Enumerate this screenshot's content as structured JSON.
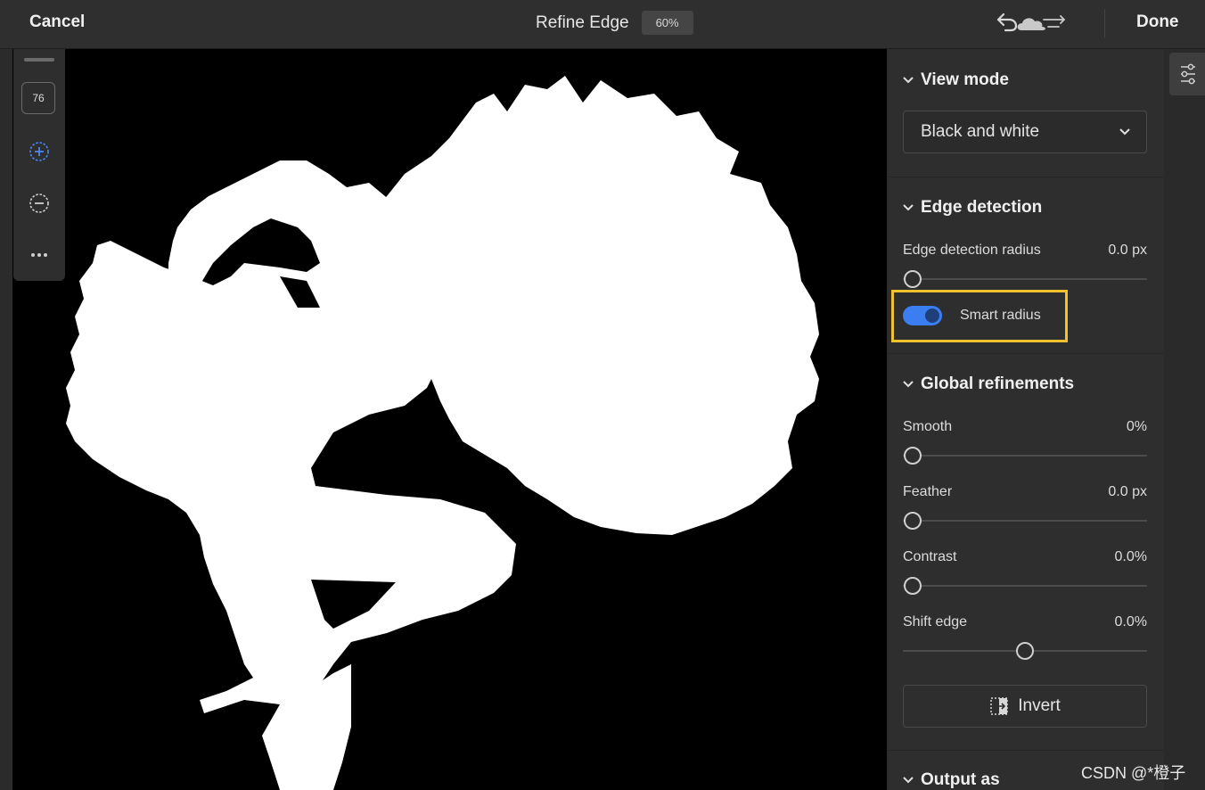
{
  "topbar": {
    "cancel_label": "Cancel",
    "title": "Refine Edge",
    "zoom": "60%",
    "done_label": "Done"
  },
  "tools": {
    "brush_size": "76"
  },
  "panel": {
    "view_mode": {
      "heading": "View mode",
      "selected": "Black and white"
    },
    "edge_detection": {
      "heading": "Edge detection",
      "radius_label": "Edge detection radius",
      "radius_value": "0.0 px",
      "smart_radius_label": "Smart radius",
      "smart_radius_on": true
    },
    "global_refinements": {
      "heading": "Global refinements",
      "smooth_label": "Smooth",
      "smooth_value": "0%",
      "feather_label": "Feather",
      "feather_value": "0.0 px",
      "contrast_label": "Contrast",
      "contrast_value": "0.0%",
      "shift_edge_label": "Shift edge",
      "shift_edge_value": "0.0%",
      "invert_label": "Invert"
    },
    "output": {
      "heading": "Output as"
    }
  },
  "colors": {
    "accent": "#3a7ef2",
    "highlight": "#f2c12e"
  },
  "watermark": "CSDN @*橙子"
}
